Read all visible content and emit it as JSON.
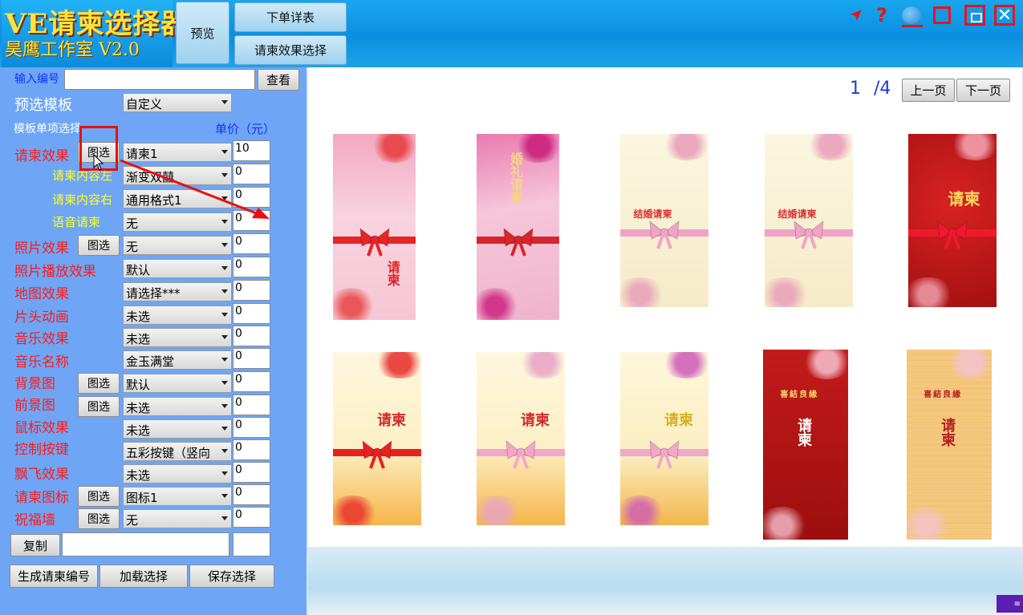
{
  "app": {
    "logo_title": "VE请柬选择器",
    "logo_subtitle": "昊鹰工作室 V2.0"
  },
  "toolbar": {
    "preview_label": "预览",
    "order_details_label": "下单详表",
    "effect_select_label": "请柬效果选择"
  },
  "window_controls": {
    "pin_icon": "arrow-icon",
    "help_icon": "?",
    "minimize_icon": "minimize-icon",
    "restore_icon": "restore-icon",
    "maximize_icon": "maximize-icon",
    "close_icon": "close-icon"
  },
  "sidebar": {
    "code_label": "输入编号",
    "code_value": "",
    "view_button": "查看",
    "template_label": "预选模板",
    "template_value": "自定义",
    "items_header": "模板单项选择",
    "price_header": "单价（元）",
    "pick_button": "图选",
    "rows": [
      {
        "label": "请柬效果",
        "value": "请柬1",
        "price": "10",
        "color": "red",
        "has_pick": true
      },
      {
        "label": "请柬内容左",
        "value": "渐变双囍",
        "price": "0",
        "color": "yellow",
        "has_pick": false
      },
      {
        "label": "请柬内容右",
        "value": "通用格式1",
        "price": "0",
        "color": "yellow",
        "has_pick": false
      },
      {
        "label": "语音请柬",
        "value": "无",
        "price": "0",
        "color": "yellow",
        "has_pick": false
      },
      {
        "label": "照片效果",
        "value": "无",
        "price": "0",
        "color": "red",
        "has_pick": true
      },
      {
        "label": "照片播放效果",
        "value": "默认",
        "price": "0",
        "color": "red",
        "has_pick": false
      },
      {
        "label": "地图效果",
        "value": "请选择***",
        "price": "0",
        "color": "red",
        "has_pick": false
      },
      {
        "label": "片头动画",
        "value": "未选",
        "price": "0",
        "color": "red",
        "has_pick": false
      },
      {
        "label": "音乐效果",
        "value": "未选",
        "price": "0",
        "color": "red",
        "has_pick": false
      },
      {
        "label": "音乐名称",
        "value": "金玉满堂",
        "price": "0",
        "color": "red",
        "has_pick": false
      },
      {
        "label": "背景图",
        "value": "默认",
        "price": "0",
        "color": "red",
        "has_pick": true
      },
      {
        "label": "前景图",
        "value": "未选",
        "price": "0",
        "color": "red",
        "has_pick": true
      },
      {
        "label": "鼠标效果",
        "value": "未选",
        "price": "0",
        "color": "red",
        "has_pick": false
      },
      {
        "label": "控制按键",
        "value": "五彩按键（竖向",
        "price": "0",
        "color": "red",
        "has_pick": false
      },
      {
        "label": "飘飞效果",
        "value": "未选",
        "price": "0",
        "color": "red",
        "has_pick": false
      },
      {
        "label": "请柬图标",
        "value": "图标1",
        "price": "0",
        "color": "red",
        "has_pick": true
      },
      {
        "label": "祝福墙",
        "value": "无",
        "price": "0",
        "color": "red",
        "has_pick": true
      }
    ],
    "copy_button": "复制",
    "copy_field_value": "",
    "total_value": "",
    "generate_button": "生成请柬编号",
    "load_button": "加载选择",
    "save_button": "保存选择"
  },
  "gallery": {
    "current_page": "1",
    "total_pages": "/4",
    "prev_button": "上一页",
    "next_button": "下一页",
    "cards": [
      {
        "bg": "#f6c9d7",
        "accent": "#e63a3a",
        "ribbon": "#e62525",
        "text": "请柬",
        "text_color": "#d22",
        "style": "pink-floral"
      },
      {
        "bg": "#f3b8cf",
        "accent": "#c9187a",
        "ribbon": "#d8252b",
        "text": "婚礼请柬",
        "text_color": "#f5d48a",
        "style": "pink-diag"
      },
      {
        "bg": "#fbf1d2",
        "accent": "#e89ab8",
        "ribbon": "#f1a3c6",
        "text": "结婚请柬",
        "text_color": "#d83030",
        "style": "cream"
      },
      {
        "bg": "#fbf1d2",
        "accent": "#e89ab8",
        "ribbon": "#f1a3c6",
        "text": "结婚请柬",
        "text_color": "#d83030",
        "style": "cream"
      },
      {
        "bg": "#c91a1a",
        "accent": "#f6a7b4",
        "ribbon": "#f0182c",
        "text": "请柬",
        "text_color": "#f8dd60",
        "style": "red"
      },
      {
        "bg": "#fdf3d6",
        "accent": "#e82a2a",
        "ribbon": "#e82020",
        "text": "请柬",
        "text_color": "#d52a2a",
        "style": "gold-red"
      },
      {
        "bg": "#fdf0c8",
        "accent": "#e6a1c6",
        "ribbon": "#f3a6cc",
        "text": "请柬",
        "text_color": "#d52a2a",
        "style": "gold-pink"
      },
      {
        "bg": "#fbf0c9",
        "accent": "#cf59b8",
        "ribbon": "#f0a8c9",
        "text": "请柬",
        "text_color": "#d8b120",
        "style": "lily"
      },
      {
        "bg": "#b81616",
        "accent": "#f6c2d0",
        "ribbon": "#b81616",
        "text": "请柬",
        "text_color": "#ffffff",
        "style": "dark-red"
      },
      {
        "bg": "#f3c47a",
        "accent": "#f6c2d0",
        "ribbon": "#f3c47a",
        "text": "请柬",
        "text_color": "#b22020",
        "style": "gold-grid"
      }
    ],
    "card_subtexts": [
      "喜結良緣",
      "喜結良緣"
    ]
  },
  "colors": {
    "accent_blue": "#0a8fe0",
    "sidebar_bg": "#6ea6f5",
    "highlight_red": "#e81010"
  }
}
